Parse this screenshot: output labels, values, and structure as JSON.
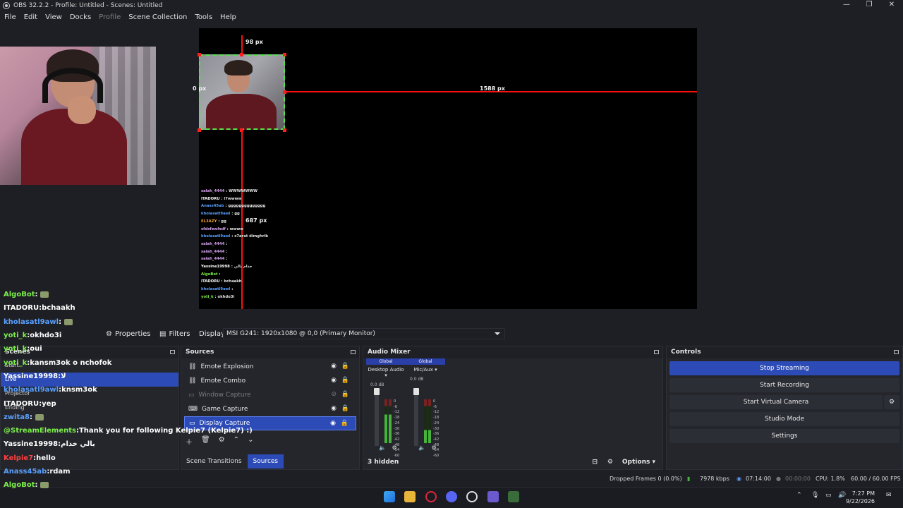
{
  "window": {
    "title": "OBS 32.2.2 - Profile: Untitled - Scenes: Untitled",
    "controls": [
      "—",
      "❐",
      "✕"
    ]
  },
  "menu": [
    "File",
    "Edit",
    "View",
    "Docks",
    "Profile",
    "Scene Collection",
    "Tools",
    "Help"
  ],
  "preview": {
    "dim_top": "98 px",
    "dim_left": "0 px",
    "dim_right": "1588 px",
    "dim_bottom": "687 px",
    "chat_overlay_lines": [
      {
        "user": "salah_4444",
        "msg": "WWWWWWW",
        "color": "#d6a4f0"
      },
      {
        "user": "ITADORU",
        "msg": "l7wwww",
        "color": "#ffffff"
      },
      {
        "user": "Anass45ab",
        "msg": "gggggggggggggg",
        "color": "#5aa0ff"
      },
      {
        "user": "kholasatl9awl",
        "msg": "gg",
        "color": "#5aa0ff"
      },
      {
        "user": "EL3AZY",
        "msg": "gg",
        "color": "#f0a030"
      },
      {
        "user": "sfdsfewfsdf",
        "msg": "wwww",
        "color": "#d6a4f0"
      },
      {
        "user": "kholasatl9awl",
        "msg": "s7arat dimghrib",
        "color": "#5aa0ff"
      },
      {
        "user": "salah_4444",
        "msg": "",
        "color": "#d6a4f0"
      },
      {
        "user": "salah_4444",
        "msg": "",
        "color": "#d6a4f0"
      },
      {
        "user": "salah_4444",
        "msg": "",
        "color": "#d6a4f0"
      },
      {
        "user": "Yassine19998",
        "msg": "خدام بالي",
        "color": "#ffffff"
      },
      {
        "user": "AlgoBot",
        "msg": "",
        "color": "#7cf04a"
      },
      {
        "user": "ITADORU",
        "msg": "bchaakh",
        "color": "#ffffff"
      },
      {
        "user": "kholasatl9awl",
        "msg": "",
        "color": "#5aa0ff"
      },
      {
        "user": "yoti_k",
        "msg": "okhdo3i",
        "color": "#7cf04a"
      }
    ]
  },
  "chat_left": [
    {
      "user": "AlgoBot",
      "msg": "",
      "color": "#7cf04a",
      "emote": true
    },
    {
      "user": "ITADORU",
      "msg": "bchaakh",
      "color": "#ffffff",
      "emote": false
    },
    {
      "user": "kholasatl9awl",
      "msg": "",
      "color": "#5aa0ff",
      "emote": true
    },
    {
      "user": "yoti_k",
      "msg": "okhdo3i",
      "color": "#7cf04a",
      "emote": false
    },
    {
      "user": "yoti_k",
      "msg": "oui",
      "color": "#7cf04a",
      "emote": false
    },
    {
      "user": "yoti_k",
      "msg": "kansm3ok o nchofok",
      "color": "#7cf04a",
      "emote": false
    },
    {
      "user": "Yassine19998",
      "msg": "لا",
      "color": "#ffffff",
      "emote": false
    },
    {
      "user": "kholasatl9awl",
      "msg": "knsm3ok",
      "color": "#5aa0ff",
      "emote": false
    },
    {
      "user": "ITADORU",
      "msg": "yep",
      "color": "#ffffff",
      "emote": false
    },
    {
      "user": "zwita8",
      "msg": "",
      "color": "#5aa0ff",
      "emote": true
    },
    {
      "user": "@StreamElements",
      "msg": "Thank you for following Kelpie7 (Kelpie7) :)",
      "color": "#7cf04a",
      "emote": false
    },
    {
      "user": "Yassine19998",
      "msg": "بالي خدام",
      "color": "#ffffff",
      "emote": false
    },
    {
      "user": "Kelpie7",
      "msg": "hello",
      "color": "#ff4040",
      "emote": false
    },
    {
      "user": "Anass45ab",
      "msg": "rdam",
      "color": "#5aa0ff",
      "emote": false
    },
    {
      "user": "AlgoBot",
      "msg": "",
      "color": "#7cf04a",
      "emote": true
    }
  ],
  "toolbar": {
    "properties": "Properties",
    "filters": "Filters",
    "display_label": "Display",
    "display_value": "MSI G241: 1920x1080 @ 0,0 (Primary Monitor)"
  },
  "scenes": {
    "title": "Scenes",
    "items": [
      "Start",
      "Live",
      "Projector",
      "Ending"
    ],
    "selected": 1
  },
  "sources": {
    "title": "Sources",
    "items": [
      {
        "name": "Emote Explosion",
        "icon": "link-icon",
        "dim": false,
        "selected": false
      },
      {
        "name": "Emote Combo",
        "icon": "link-icon",
        "dim": false,
        "selected": false
      },
      {
        "name": "Window Capture",
        "icon": "window-icon",
        "dim": true,
        "selected": false
      },
      {
        "name": "Game Capture",
        "icon": "gamepad-icon",
        "dim": false,
        "selected": false
      },
      {
        "name": "Display Capture",
        "icon": "monitor-icon",
        "dim": false,
        "selected": true
      }
    ]
  },
  "bottom_tabs": {
    "scene_transitions": "Scene Transitions",
    "sources": "Sources"
  },
  "audio_mixer": {
    "title": "Audio Mixer",
    "channels": [
      {
        "global": "Global",
        "name": "Desktop Audio",
        "db": "0.0 dB",
        "level": 0.65
      },
      {
        "global": "Global",
        "name": "Mic/Aux",
        "db": "0.0 dB",
        "level": 0.3
      }
    ],
    "scale": [
      "0",
      "-6",
      "-12",
      "-18",
      "-24",
      "-30",
      "-36",
      "-42",
      "-48",
      "-54",
      "-60"
    ],
    "hidden": "3 hidden",
    "options": "Options"
  },
  "controls": {
    "title": "Controls",
    "stop_streaming": "Stop Streaming",
    "start_recording": "Start Recording",
    "start_virtual_camera": "Start Virtual Camera",
    "studio_mode": "Studio Mode",
    "settings": "Settings"
  },
  "status": {
    "dropped_frames": "Dropped Frames 0 (0.0%)",
    "kbps": "7978 kbps",
    "stream_time": "07:14:00",
    "rec_time": "00:00:00",
    "cpu": "CPU: 1.8%",
    "fps": "60.00 / 60.00 FPS"
  },
  "taskbar": {
    "time": "7:27 PM",
    "date": "9/22/2026"
  },
  "colors": {
    "accent": "#2c4bb6",
    "selection_green": "#55e34a",
    "guide_red": "#ff1010"
  }
}
